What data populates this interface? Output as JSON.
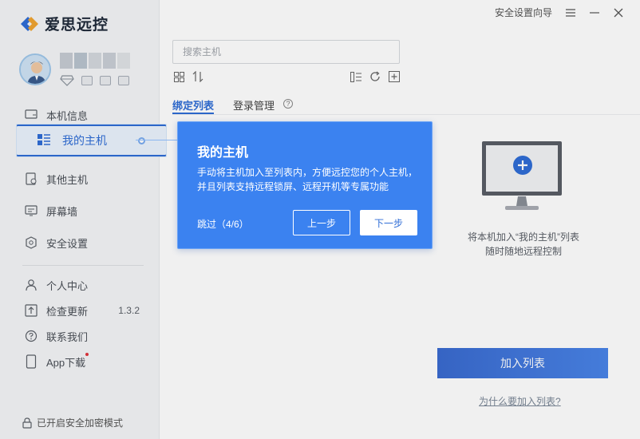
{
  "app": {
    "logo_text": "爱思远控"
  },
  "titlebar": {
    "security_wizard": "安全设置向导"
  },
  "sidebar": {
    "active_item": "我的主机",
    "items": [
      {
        "label": "本机信息",
        "icon": "monitor-icon"
      },
      {
        "label": "我的主机",
        "icon": "host-list-icon"
      },
      {
        "label": "其他主机",
        "icon": "other-host-icon"
      },
      {
        "label": "屏幕墙",
        "icon": "screen-wall-icon"
      },
      {
        "label": "安全设置",
        "icon": "shield-gear-icon"
      }
    ],
    "lower_items": [
      {
        "label": "个人中心",
        "icon": "user-icon"
      },
      {
        "label": "检查更新",
        "icon": "update-icon",
        "version": "1.3.2"
      },
      {
        "label": "联系我们",
        "icon": "help-circle-icon"
      },
      {
        "label": "App下载",
        "icon": "phone-icon"
      }
    ],
    "footer": "已开启安全加密模式"
  },
  "main": {
    "search_placeholder": "搜索主机",
    "tabs": [
      "绑定列表",
      "登录管理"
    ],
    "help_glyph": "?",
    "empty_text_line1": "将本机加入“我的主机”列表",
    "empty_text_line2": "随时随地远程控制",
    "add_button": "加入列表",
    "why_link": "为什么要加入列表?"
  },
  "guide": {
    "title": "我的主机",
    "body": "手动将主机加入至列表内，方便远控您的个人主机，并且列表支持远程锁屏、远程开机等专属功能",
    "skip": "跳过（4/6）",
    "prev": "上一步",
    "next": "下一步"
  },
  "colors": {
    "accent": "#2f6dd6",
    "guide_bg": "#3b82f0",
    "sidebar_bg": "#f4f5f7"
  }
}
